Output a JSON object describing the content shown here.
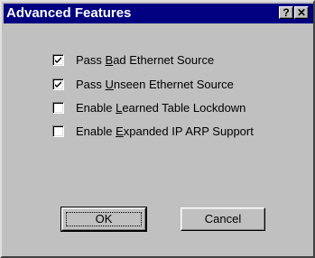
{
  "window": {
    "title": "Advanced Features",
    "help_button": "?",
    "close_button": "✕"
  },
  "options": [
    {
      "label_pre": "Pass ",
      "label_key": "B",
      "label_post": "ad Ethernet Source",
      "checked": true
    },
    {
      "label_pre": "Pass ",
      "label_key": "U",
      "label_post": "nseen Ethernet Source",
      "checked": true
    },
    {
      "label_pre": "Enable ",
      "label_key": "L",
      "label_post": "earned Table Lockdown",
      "checked": false
    },
    {
      "label_pre": "Enable ",
      "label_key": "E",
      "label_post": "xpanded IP ARP Support",
      "checked": false
    }
  ],
  "buttons": {
    "ok": "OK",
    "cancel": "Cancel"
  }
}
